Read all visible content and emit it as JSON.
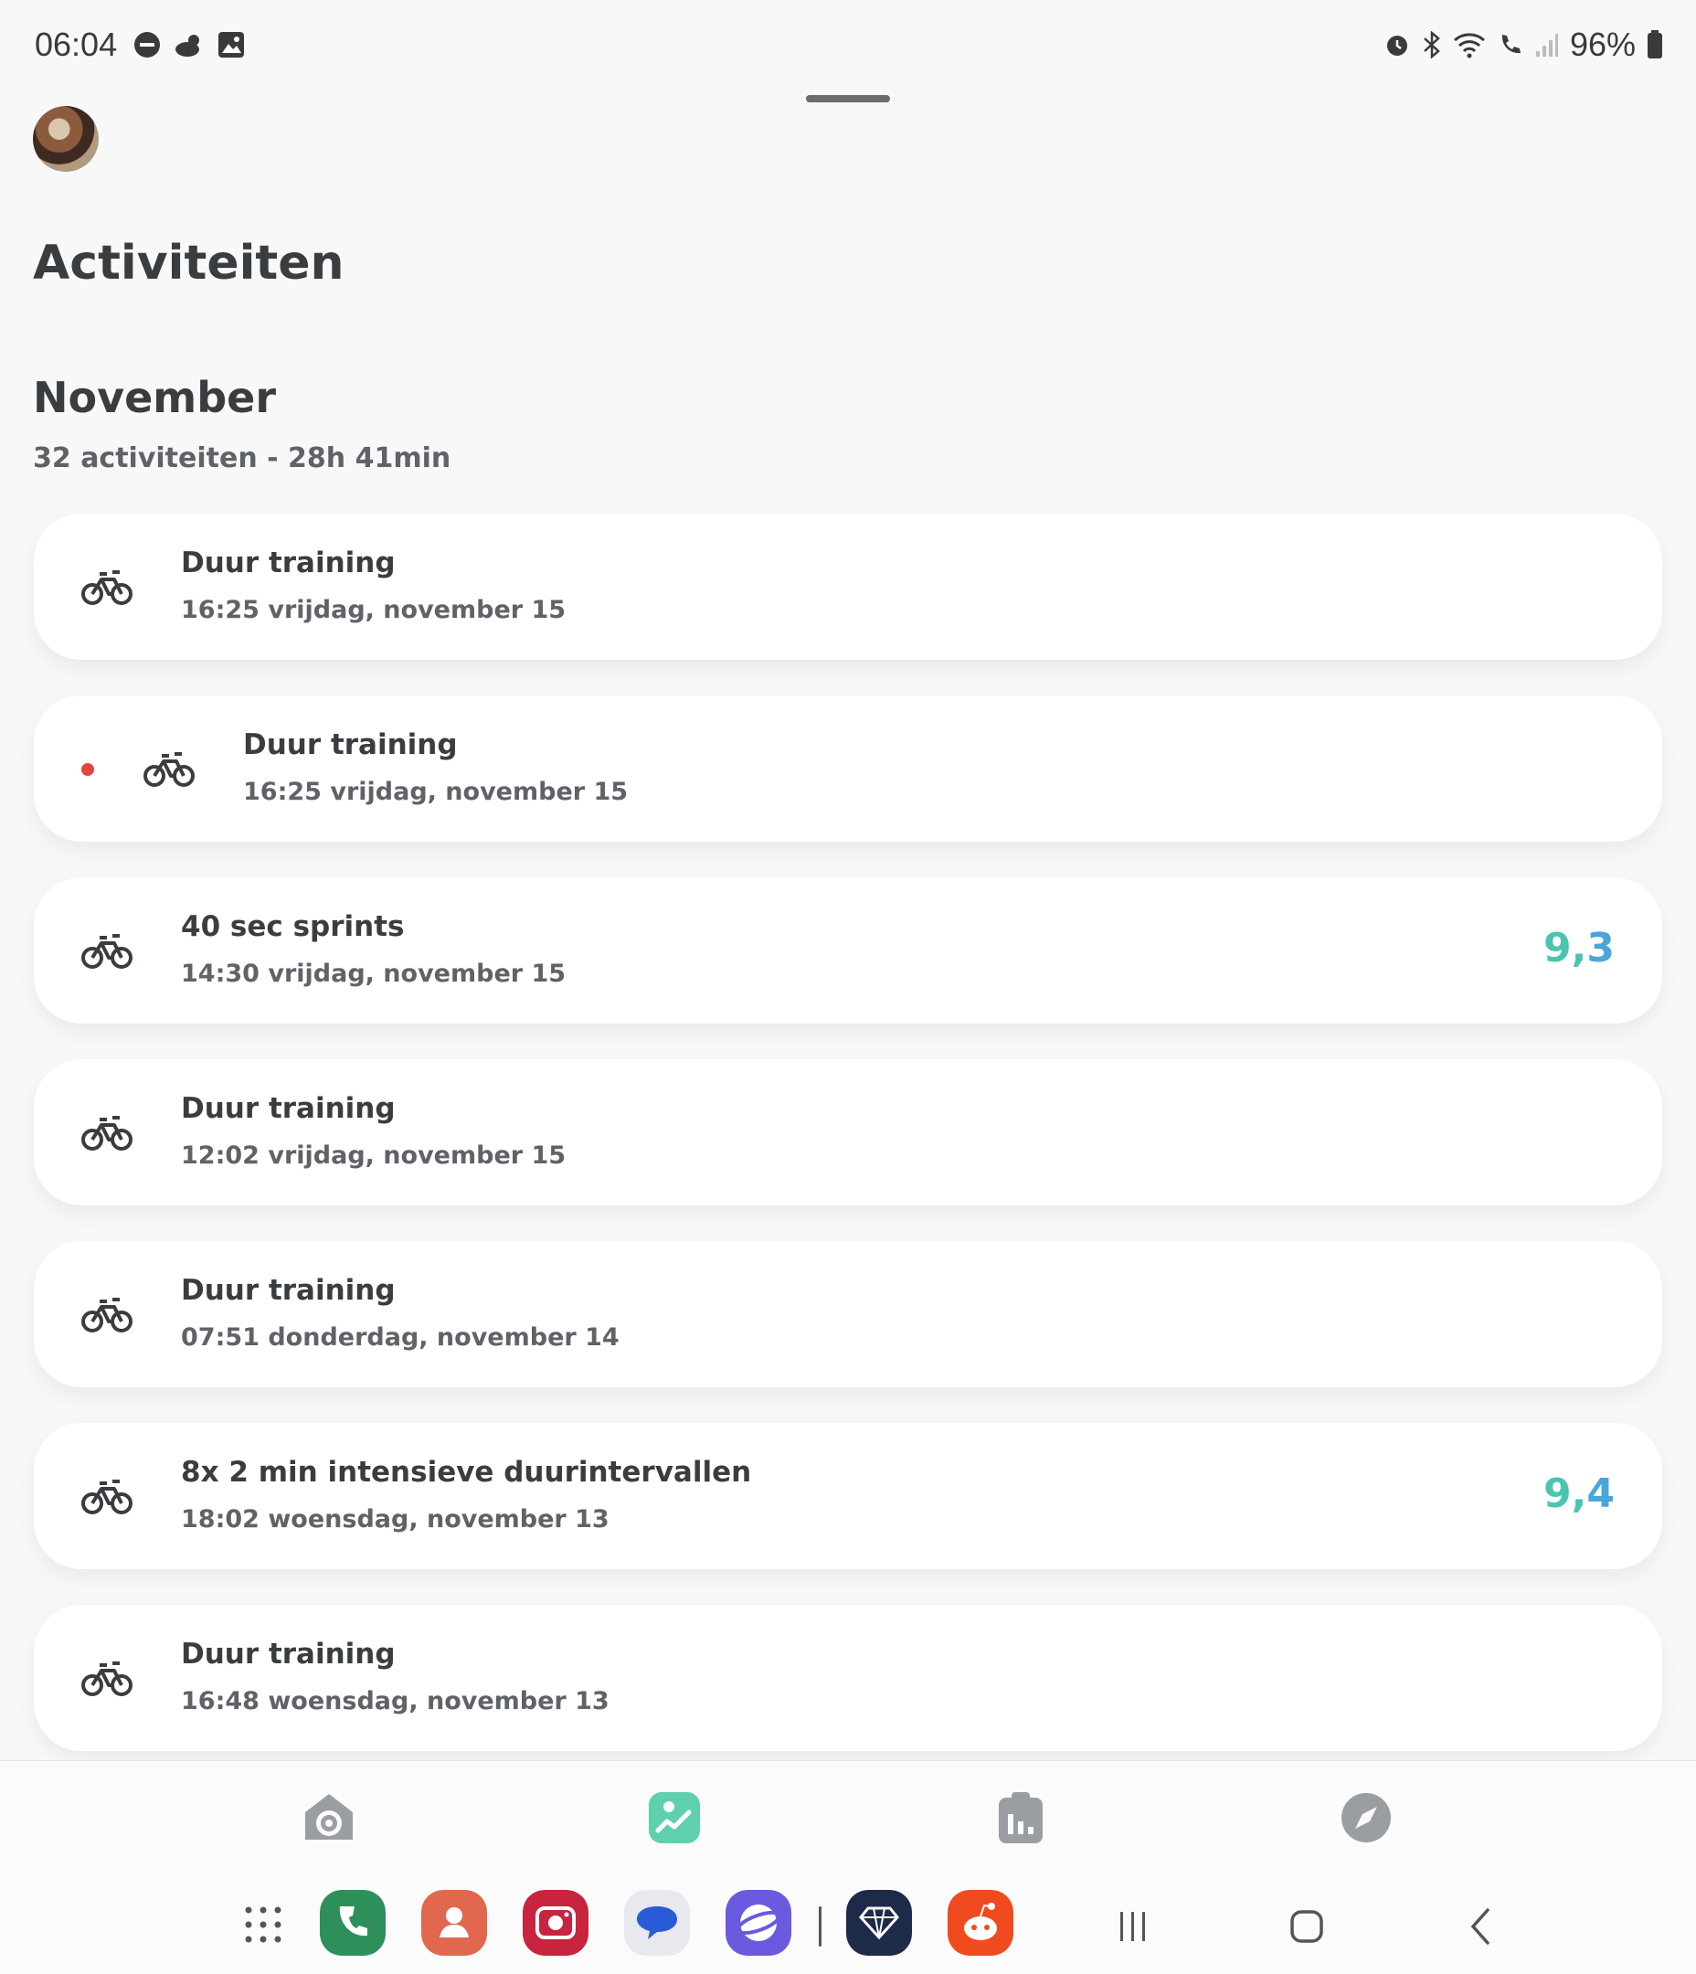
{
  "status_bar": {
    "time": "06:04",
    "left_icons": [
      "dnd-icon",
      "weather-icon",
      "gallery-icon"
    ],
    "right_icons": [
      "alarm-icon",
      "bluetooth-icon",
      "wifi-icon",
      "wifi-call-icon",
      "signal-icon",
      "battery-icon"
    ],
    "battery": "96%"
  },
  "header": {
    "title": "Activiteiten"
  },
  "month": {
    "title": "November",
    "summary": "32 activiteiten - 28h 41min"
  },
  "activities": [
    {
      "icon": "bike-icon",
      "title": "Duur training",
      "subtitle": "16:25 vrijdag, november 15",
      "dot": false,
      "score_whole": "",
      "score_dec": ""
    },
    {
      "icon": "bike-icon",
      "title": "Duur training",
      "subtitle": "16:25 vrijdag, november 15",
      "dot": true,
      "score_whole": "",
      "score_dec": ""
    },
    {
      "icon": "bike-icon",
      "title": "40 sec sprints",
      "subtitle": "14:30 vrijdag, november 15",
      "dot": false,
      "score_whole": "9,",
      "score_dec": "3"
    },
    {
      "icon": "bike-icon",
      "title": "Duur training",
      "subtitle": "12:02 vrijdag, november 15",
      "dot": false,
      "score_whole": "",
      "score_dec": ""
    },
    {
      "icon": "bike-icon",
      "title": "Duur training",
      "subtitle": "07:51 donderdag, november 14",
      "dot": false,
      "score_whole": "",
      "score_dec": ""
    },
    {
      "icon": "bike-icon",
      "title": "8x 2 min intensieve duurintervallen",
      "subtitle": "18:02 woensdag, november 13",
      "dot": false,
      "score_whole": "9,",
      "score_dec": "4"
    },
    {
      "icon": "bike-icon",
      "title": "Duur training",
      "subtitle": "16:48 woensdag, november 13",
      "dot": false,
      "score_whole": "",
      "score_dec": ""
    }
  ],
  "tabs": [
    {
      "name": "tab-home",
      "icon": "home-target-icon",
      "active": false
    },
    {
      "name": "tab-activities",
      "icon": "activity-chart-icon",
      "active": true
    },
    {
      "name": "tab-workouts",
      "icon": "clipboard-chart-icon",
      "active": false
    },
    {
      "name": "tab-explore",
      "icon": "compass-icon",
      "active": false
    }
  ],
  "dock": {
    "apps": [
      {
        "name": "phone-app",
        "color": "#2f8f5b"
      },
      {
        "name": "contacts-app",
        "color": "#e2674f"
      },
      {
        "name": "camera-app",
        "color": "#c8243f"
      },
      {
        "name": "messages-app",
        "color": "#e7e9ee"
      },
      {
        "name": "internet-app",
        "color": "#6a5adf"
      },
      {
        "name": "wallet-app",
        "color": "#1d2a48"
      },
      {
        "name": "reddit-app",
        "color": "#f04a1f"
      }
    ]
  },
  "colors": {
    "accent_teal": "#4cc5b0",
    "accent_blue": "#4aa6d8",
    "notification_dot": "#e5463b"
  }
}
